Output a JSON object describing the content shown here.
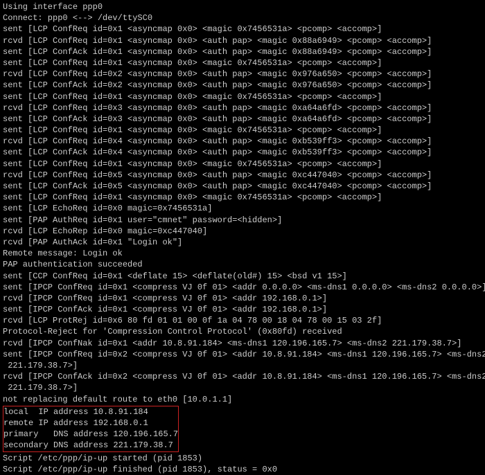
{
  "terminal": {
    "lines": [
      "Using interface ppp0",
      "Connect: ppp0 <--> /dev/ttySC0",
      "sent [LCP ConfReq id=0x1 <asyncmap 0x0> <magic 0x7456531a> <pcomp> <accomp>]",
      "rcvd [LCP ConfReq id=0x1 <asyncmap 0x0> <auth pap> <magic 0x88a6949> <pcomp> <accomp>]",
      "sent [LCP ConfAck id=0x1 <asyncmap 0x0> <auth pap> <magic 0x88a6949> <pcomp> <accomp>]",
      "sent [LCP ConfReq id=0x1 <asyncmap 0x0> <magic 0x7456531a> <pcomp> <accomp>]",
      "rcvd [LCP ConfReq id=0x2 <asyncmap 0x0> <auth pap> <magic 0x976a650> <pcomp> <accomp>]",
      "sent [LCP ConfAck id=0x2 <asyncmap 0x0> <auth pap> <magic 0x976a650> <pcomp> <accomp>]",
      "sent [LCP ConfReq id=0x1 <asyncmap 0x0> <magic 0x7456531a> <pcomp> <accomp>]",
      "rcvd [LCP ConfReq id=0x3 <asyncmap 0x0> <auth pap> <magic 0xa64a6fd> <pcomp> <accomp>]",
      "sent [LCP ConfAck id=0x3 <asyncmap 0x0> <auth pap> <magic 0xa64a6fd> <pcomp> <accomp>]",
      "sent [LCP ConfReq id=0x1 <asyncmap 0x0> <magic 0x7456531a> <pcomp> <accomp>]",
      "rcvd [LCP ConfReq id=0x4 <asyncmap 0x0> <auth pap> <magic 0xb539ff3> <pcomp> <accomp>]",
      "sent [LCP ConfAck id=0x4 <asyncmap 0x0> <auth pap> <magic 0xb539ff3> <pcomp> <accomp>]",
      "sent [LCP ConfReq id=0x1 <asyncmap 0x0> <magic 0x7456531a> <pcomp> <accomp>]",
      "rcvd [LCP ConfReq id=0x5 <asyncmap 0x0> <auth pap> <magic 0xc447040> <pcomp> <accomp>]",
      "sent [LCP ConfAck id=0x5 <asyncmap 0x0> <auth pap> <magic 0xc447040> <pcomp> <accomp>]",
      "sent [LCP ConfReq id=0x1 <asyncmap 0x0> <magic 0x7456531a> <pcomp> <accomp>]",
      "sent [LCP EchoReq id=0x0 magic=0x7456531a]",
      "sent [PAP AuthReq id=0x1 user=\"cmnet\" password=<hidden>]",
      "rcvd [LCP EchoRep id=0x0 magic=0xc447040]",
      "rcvd [PAP AuthAck id=0x1 \"Login ok\"]",
      "Remote message: Login ok",
      "PAP authentication succeeded",
      "sent [CCP ConfReq id=0x1 <deflate 15> <deflate(old#) 15> <bsd v1 15>]",
      "sent [IPCP ConfReq id=0x1 <compress VJ 0f 01> <addr 0.0.0.0> <ms-dns1 0.0.0.0> <ms-dns2 0.0.0.0>]",
      "rcvd [IPCP ConfReq id=0x1 <compress VJ 0f 01> <addr 192.168.0.1>]",
      "sent [IPCP ConfAck id=0x1 <compress VJ 0f 01> <addr 192.168.0.1>]",
      "rcvd [LCP ProtRej id=0x6 80 fd 01 01 00 0f 1a 04 78 00 18 04 78 00 15 03 2f]",
      "Protocol-Reject for 'Compression Control Protocol' (0x80fd) received",
      "rcvd [IPCP ConfNak id=0x1 <addr 10.8.91.184> <ms-dns1 120.196.165.7> <ms-dns2 221.179.38.7>]",
      "sent [IPCP ConfReq id=0x2 <compress VJ 0f 01> <addr 10.8.91.184> <ms-dns1 120.196.165.7> <ms-dns2",
      " 221.179.38.7>]",
      "rcvd [IPCP ConfAck id=0x2 <compress VJ 0f 01> <addr 10.8.91.184> <ms-dns1 120.196.165.7> <ms-dns2",
      " 221.179.38.7>]",
      "not replacing default route to eth0 [10.0.1.1]"
    ],
    "highlighted": [
      "local  IP address 10.8.91.184",
      "remote IP address 192.168.0.1",
      "primary   DNS address 120.196.165.7",
      "secondary DNS address 221.179.38.7"
    ],
    "footer": [
      "Script /etc/ppp/ip-up started (pid 1853)",
      "Script /etc/ppp/ip-up finished (pid 1853), status = 0x0"
    ]
  }
}
